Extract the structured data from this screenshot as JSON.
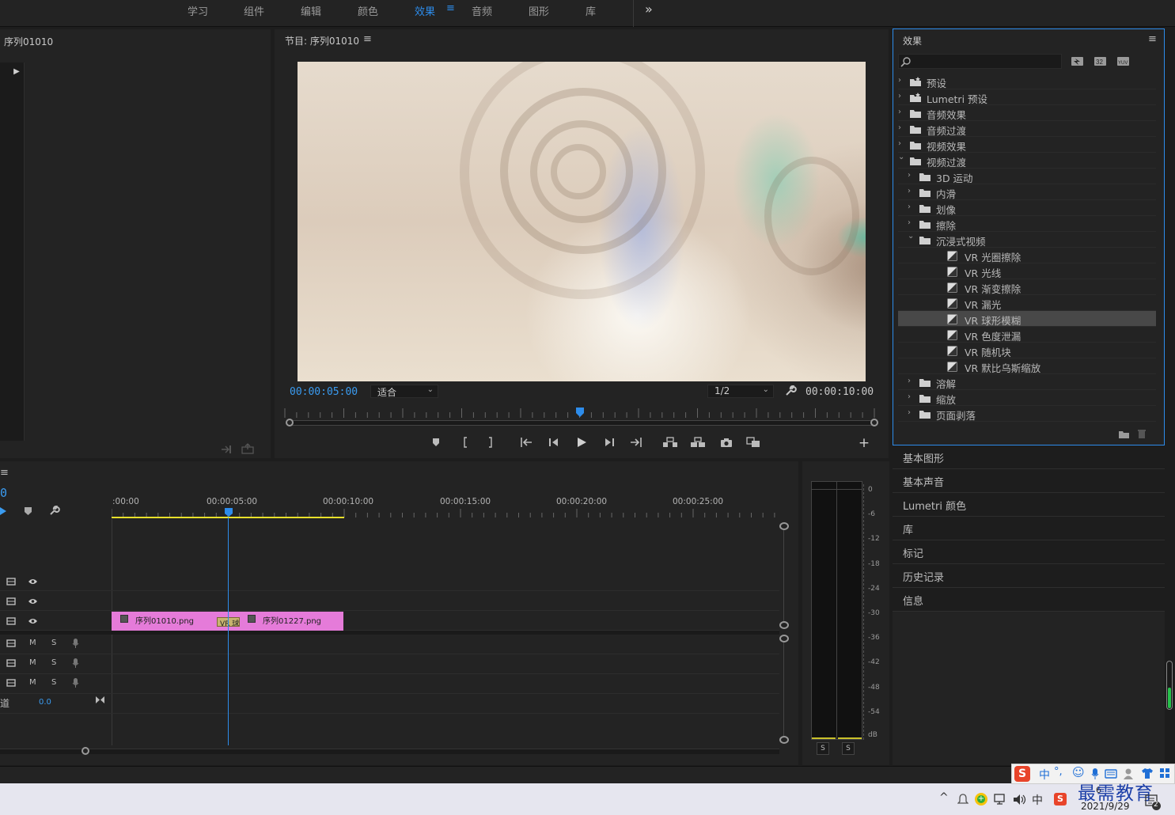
{
  "workspace_tabs": [
    "学习",
    "组件",
    "编辑",
    "颜色",
    "效果",
    "音频",
    "图形",
    "库"
  ],
  "more_tabs": "»",
  "source_panel": {
    "title": "序列01010"
  },
  "program": {
    "title": "节目: 序列01010",
    "timecode_current": "00:00:05:00",
    "fit": "适合",
    "resolution": "1/2",
    "timecode_duration": "00:00:10:00"
  },
  "effects": {
    "title": "效果",
    "search_placeholder": "",
    "buttons": [
      "accelerated-effects",
      "32-bit",
      "YUV"
    ],
    "tree": [
      {
        "label": "预设",
        "level": 0,
        "expanded": false,
        "kind": "preset"
      },
      {
        "label": "Lumetri 预设",
        "level": 0,
        "expanded": false,
        "kind": "preset"
      },
      {
        "label": "音频效果",
        "level": 0,
        "expanded": false,
        "kind": "folder"
      },
      {
        "label": "音频过渡",
        "level": 0,
        "expanded": false,
        "kind": "folder"
      },
      {
        "label": "视频效果",
        "level": 0,
        "expanded": false,
        "kind": "folder"
      },
      {
        "label": "视频过渡",
        "level": 0,
        "expanded": true,
        "kind": "folder"
      },
      {
        "label": "3D 运动",
        "level": 1,
        "expanded": false,
        "kind": "folder"
      },
      {
        "label": "内滑",
        "level": 1,
        "expanded": false,
        "kind": "folder"
      },
      {
        "label": "划像",
        "level": 1,
        "expanded": false,
        "kind": "folder"
      },
      {
        "label": "擦除",
        "level": 1,
        "expanded": false,
        "kind": "folder"
      },
      {
        "label": "沉浸式视频",
        "level": 1,
        "expanded": true,
        "kind": "folder"
      },
      {
        "label": "VR 光圈擦除",
        "level": 2,
        "kind": "effect"
      },
      {
        "label": "VR 光线",
        "level": 2,
        "kind": "effect"
      },
      {
        "label": "VR 渐变擦除",
        "level": 2,
        "kind": "effect"
      },
      {
        "label": "VR 漏光",
        "level": 2,
        "kind": "effect"
      },
      {
        "label": "VR 球形模糊",
        "level": 2,
        "kind": "effect",
        "selected": true
      },
      {
        "label": "VR 色度泄漏",
        "level": 2,
        "kind": "effect"
      },
      {
        "label": "VR 随机块",
        "level": 2,
        "kind": "effect"
      },
      {
        "label": "VR 默比乌斯缩放",
        "level": 2,
        "kind": "effect"
      },
      {
        "label": "溶解",
        "level": 1,
        "expanded": false,
        "kind": "folder"
      },
      {
        "label": "缩放",
        "level": 1,
        "expanded": false,
        "kind": "folder"
      },
      {
        "label": "页面剥落",
        "level": 1,
        "expanded": false,
        "kind": "folder"
      }
    ]
  },
  "side_panels": [
    "基本图形",
    "基本声音",
    "Lumetri 颜色",
    "库",
    "标记",
    "历史记录",
    "信息"
  ],
  "timeline": {
    "timecode": "0",
    "ruler": [
      ":00:00",
      "00:00:05:00",
      "00:00:10:00",
      "00:00:15:00",
      "00:00:20:00",
      "00:00:25:00"
    ],
    "clip1": "序列01010.png",
    "clip2": "序列01227.png",
    "transition": "VR 球",
    "audio_labels": {
      "m": "M",
      "s": "S"
    },
    "master_label": "道",
    "master_value": "0.0"
  },
  "meter": {
    "scale": [
      "0",
      "-6",
      "-12",
      "-18",
      "-24",
      "-30",
      "-36",
      "-42",
      "-48",
      "-54",
      "dB"
    ],
    "solo": [
      "S",
      "S"
    ]
  },
  "taskbar": {
    "ime_label": "中",
    "date": "2021/9/29",
    "watermark": "最需教育",
    "notification_count": "2",
    "ime_badge": "6"
  }
}
